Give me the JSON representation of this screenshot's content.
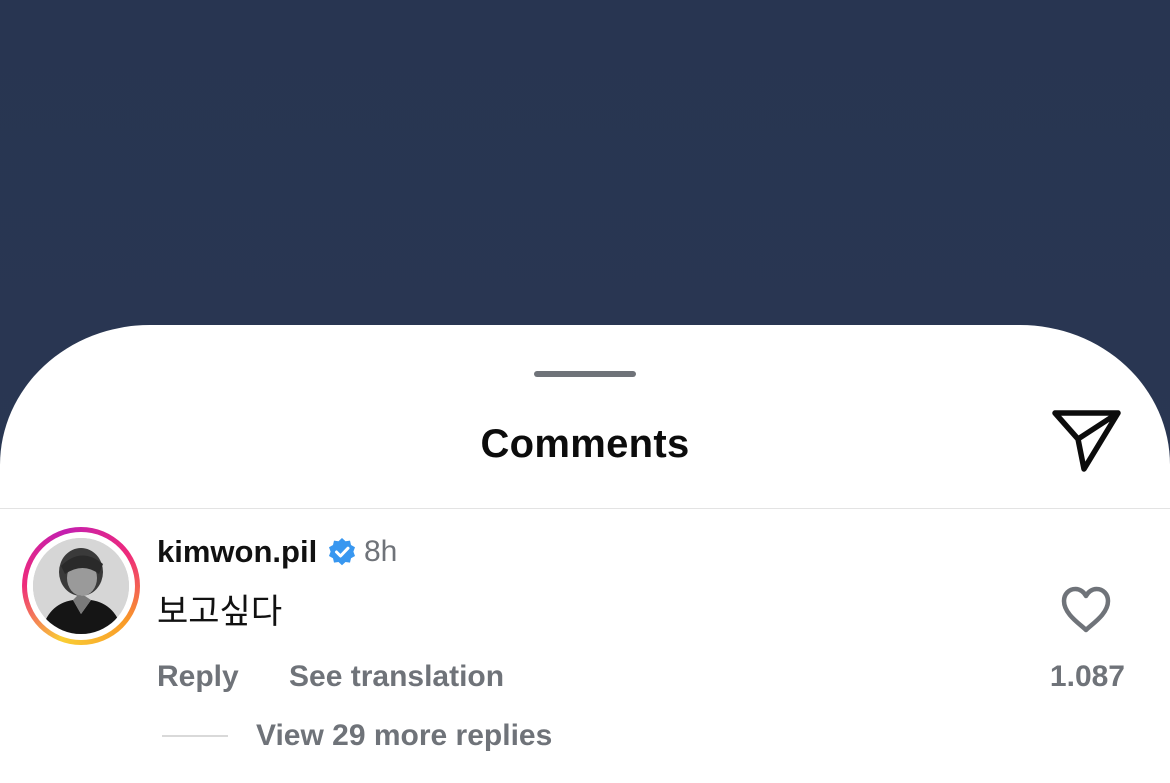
{
  "sheet": {
    "title": "Comments"
  },
  "comment": {
    "username": "kimwon.pil",
    "verified": true,
    "time": "8h",
    "text": "보고싶다",
    "like_count": "1.087",
    "reply_label": "Reply",
    "translate_label": "See translation",
    "view_replies_label": "View 29 more replies"
  },
  "colors": {
    "backdrop": "#283551",
    "sheet": "#ffffff",
    "secondary_text": "#6f7379",
    "verified_badge": "#3897f0"
  },
  "icons": {
    "share": "paper-plane-icon",
    "like": "heart-outline-icon",
    "verified": "verified-badge-icon"
  }
}
